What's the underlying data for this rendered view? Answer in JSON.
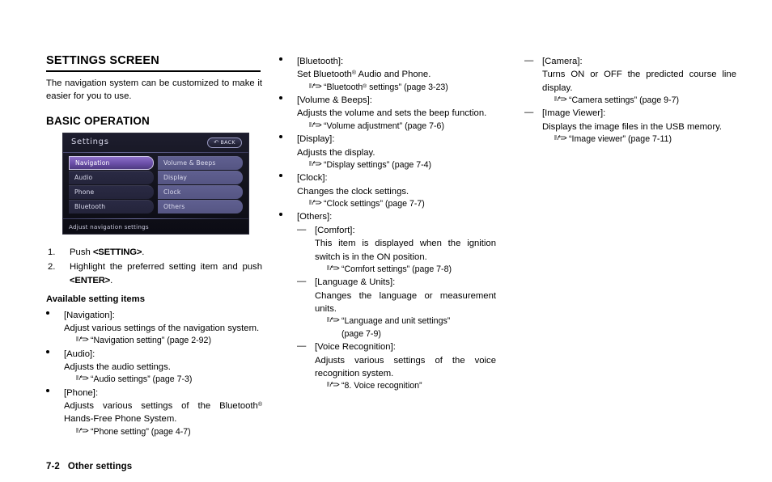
{
  "document": {
    "footer_page": "7-2",
    "footer_section": "Other settings"
  },
  "column1": {
    "heading": "SETTINGS SCREEN",
    "intro": "The navigation system can be customized to make it easier for you to use.",
    "subheading": "BASIC OPERATION",
    "screen": {
      "title": "Settings",
      "back_label": "BACK",
      "back_icon": "back-arrow-icon",
      "left_items": [
        "Navigation",
        "Audio",
        "Phone",
        "Bluetooth"
      ],
      "right_items": [
        "Volume & Beeps",
        "Display",
        "Clock",
        "Others"
      ],
      "selected_item": "Navigation",
      "status_text": "Adjust navigation settings",
      "highlight_color": "#6b4fa8",
      "panel_color": "#555583"
    },
    "steps": [
      {
        "num": "1.",
        "pre": "Push ",
        "key": "<SETTING>",
        "post": "."
      },
      {
        "num": "2.",
        "pre": "Highlight the preferred setting item and push ",
        "key": "<ENTER>",
        "post": "."
      }
    ],
    "available_heading": "Available setting items",
    "items": [
      {
        "term": "[Navigation]:",
        "desc": "Adjust various settings of the navigation system.",
        "xref": "“Navigation setting” (page 2-92)"
      },
      {
        "term": "[Audio]:",
        "desc": "Adjusts the audio settings.",
        "xref": "“Audio settings” (page 7-3)"
      },
      {
        "term": "[Phone]:",
        "desc_pre": "Adjusts various settings of the Bluetooth",
        "desc_reg": "®",
        "desc_post": " Hands-Free Phone System.",
        "xref": "“Phone setting” (page 4-7)"
      }
    ]
  },
  "column2": {
    "items": [
      {
        "term": "[Bluetooth]:",
        "desc_pre": "Set Bluetooth",
        "desc_reg": "®",
        "desc_post": " Audio and Phone.",
        "xref_pre": "“Bluetooth",
        "xref_reg": "®",
        "xref_post": " settings” (page 3-23)"
      },
      {
        "term": "[Volume & Beeps]:",
        "desc": "Adjusts the volume and sets the beep function.",
        "xref": "“Volume adjustment” (page 7-6)"
      },
      {
        "term": "[Display]:",
        "desc": "Adjusts the display.",
        "xref": "“Display settings” (page 7-4)"
      },
      {
        "term": "[Clock]:",
        "desc": "Changes the clock settings.",
        "xref": "“Clock settings” (page 7-7)"
      },
      {
        "term": "[Others]:",
        "subitems": [
          {
            "term": "[Comfort]:",
            "desc": "This item is displayed when the ignition switch is in the ON position.",
            "xref": "“Comfort settings” (page 7-8)"
          },
          {
            "term": "[Language & Units]:",
            "desc": "Changes the language or measurement units.",
            "xref": "“Language and unit settings”",
            "xref_cont": "(page 7-9)"
          },
          {
            "term": "[Voice Recognition]:",
            "desc": "Adjusts various settings of the voice recognition system.",
            "xref": "“8. Voice recognition”"
          }
        ]
      }
    ]
  },
  "column3": {
    "subitems": [
      {
        "term": "[Camera]:",
        "desc": "Turns ON or OFF the predicted course line display.",
        "xref": "“Camera settings” (page 9-7)"
      },
      {
        "term": "[Image Viewer]:",
        "desc": "Displays the image files in the USB memory.",
        "xref": "“Image viewer” (page 7-11)"
      }
    ]
  },
  "icons": {
    "reference_hand": "pointing-hand-icon",
    "dash": "—"
  }
}
